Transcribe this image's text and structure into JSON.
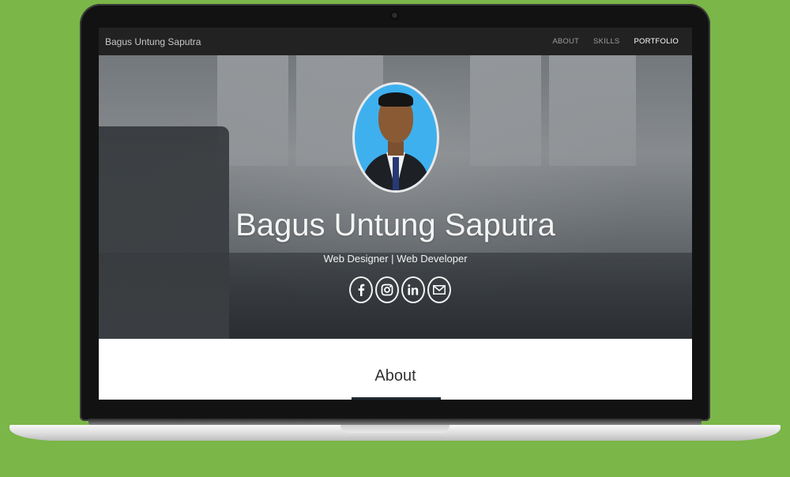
{
  "navbar": {
    "brand": "Bagus Untung Saputra",
    "links": [
      {
        "label": "ABOUT"
      },
      {
        "label": "SKILLS"
      },
      {
        "label": "PORTFOLIO"
      }
    ]
  },
  "hero": {
    "name": "Bagus Untung Saputra",
    "role": "Web Designer | Web Developer",
    "socials": [
      "facebook-icon",
      "instagram-icon",
      "linkedin-icon",
      "email-icon"
    ]
  },
  "about": {
    "title": "About"
  },
  "colors": {
    "background": "#7ab648",
    "navbar": "#222222",
    "avatar_bg": "#3fb0ee",
    "about_rule": "#1f2a33"
  }
}
